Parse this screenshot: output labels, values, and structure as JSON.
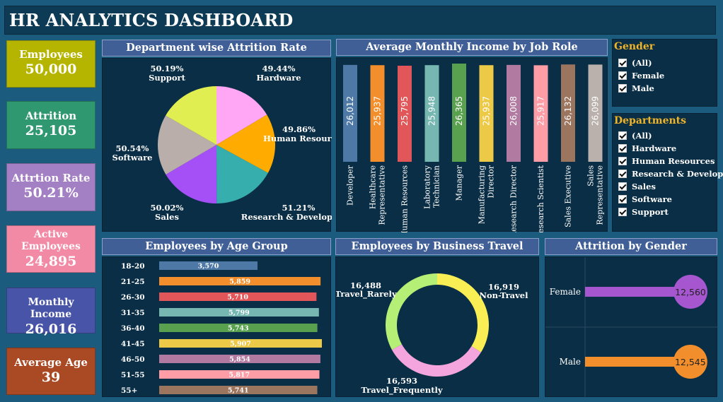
{
  "header": {
    "title": "HR ANALYTICS DASHBOARD"
  },
  "kpis": [
    {
      "label": "Employees",
      "value": "50,000",
      "color": "#b5b500",
      "text_color": "#ffffff"
    },
    {
      "label": "Attrition",
      "value": "25,105",
      "color": "#2f9870",
      "text_color": "#ffffff"
    },
    {
      "label": "Attrtion Rate",
      "value": "50.21%",
      "color": "#a37fc4",
      "text_color": "#ffffff"
    },
    {
      "label": "Active Employees",
      "value": "24,895",
      "color": "#f38aa5",
      "text_color": "#ffffff"
    },
    {
      "label": "Monthly Income",
      "value": "26,016",
      "color": "#4754a8",
      "text_color": "#ffffff"
    },
    {
      "label": "Average Age",
      "value": "39",
      "color": "#a94a25",
      "text_color": "#ffffff"
    }
  ],
  "filters": {
    "gender": {
      "title": "Gender",
      "items": [
        "(All)",
        "Female",
        "Male"
      ]
    },
    "departments": {
      "title": "Departments",
      "items": [
        "(All)",
        "Hardware",
        "Human Resources",
        "Research & Develop…",
        "Sales",
        "Software",
        "Support"
      ]
    }
  },
  "chart_data": [
    {
      "type": "pie",
      "title": "Department wise Attrition Rate",
      "slices": [
        {
          "label": "Hardware",
          "value": 49.44,
          "display": "49.44%",
          "color": "#ffa6f5"
        },
        {
          "label": "Human Resources",
          "value": 49.86,
          "display": "49.86%",
          "color": "#ffab00"
        },
        {
          "label": "Research & Development",
          "value": 51.21,
          "display": "51.21%",
          "color": "#36aeae"
        },
        {
          "label": "Sales",
          "value": 50.02,
          "display": "50.02%",
          "color": "#a54ff7"
        },
        {
          "label": "Software",
          "value": 50.54,
          "display": "50.54%",
          "color": "#b9aea9"
        },
        {
          "label": "Support",
          "value": 50.19,
          "display": "50.19%",
          "color": "#e1ee51"
        }
      ]
    },
    {
      "type": "bar",
      "title": "Average Monthly Income by Job Role",
      "categories": [
        [
          "Developer"
        ],
        [
          "Healthcare",
          "Representative"
        ],
        [
          "Human Resources"
        ],
        [
          "Laboratory",
          "Technician"
        ],
        [
          "Manager"
        ],
        [
          "Manufacturing",
          "Director"
        ],
        [
          "Research Director"
        ],
        [
          "Research Scientist"
        ],
        [
          "Sales Executive"
        ],
        [
          "Sales",
          "Representative"
        ]
      ],
      "values": [
        26012,
        25937,
        25795,
        25948,
        26365,
        25937,
        26008,
        25917,
        26132,
        26099
      ],
      "labels": [
        "26,012",
        "25,937",
        "25,795",
        "25,948",
        "26,365",
        "25,937",
        "26,008",
        "25,917",
        "26,132",
        "26,099"
      ],
      "colors": [
        "#4e79a7",
        "#f28e2b",
        "#e15759",
        "#76b7b2",
        "#59a14f",
        "#edc948",
        "#b07aa1",
        "#ff9da7",
        "#9c755f",
        "#bab0ac"
      ]
    },
    {
      "type": "bar",
      "title": "Employees by Age Group",
      "orientation": "horizontal",
      "categories": [
        "18-20",
        "21-25",
        "26-30",
        "31-35",
        "36-40",
        "41-45",
        "46-50",
        "51-55",
        "55+"
      ],
      "values": [
        3570,
        5859,
        5710,
        5799,
        5743,
        5907,
        5854,
        5817,
        5741
      ],
      "labels": [
        "3,570",
        "5,859",
        "5,710",
        "5,799",
        "5,743",
        "5,907",
        "5,854",
        "5,817",
        "5,741"
      ],
      "colors": [
        "#4e79a7",
        "#f28e2b",
        "#e15759",
        "#76b7b2",
        "#59a14f",
        "#edc948",
        "#b07aa1",
        "#ff9da7",
        "#9c755f"
      ]
    },
    {
      "type": "pie",
      "subtype": "donut",
      "title": "Employees by Business Travel",
      "slices": [
        {
          "label": "Non-Travel",
          "value": 16919,
          "display": "16,919",
          "color": "#f9ef54"
        },
        {
          "label": "Travel_Frequently",
          "value": 16593,
          "display": "16,593",
          "color": "#f5a5dd"
        },
        {
          "label": "Travel_Rarely",
          "value": 16488,
          "display": "16,488",
          "color": "#b6ef76"
        }
      ]
    },
    {
      "type": "bar",
      "subtype": "lollipop",
      "title": "Attrition by Gender",
      "categories": [
        "Female",
        "Male"
      ],
      "values": [
        12560,
        12545
      ],
      "labels": [
        "12,560",
        "12,545"
      ],
      "colors": [
        "#a657cf",
        "#f28e2b"
      ]
    }
  ]
}
